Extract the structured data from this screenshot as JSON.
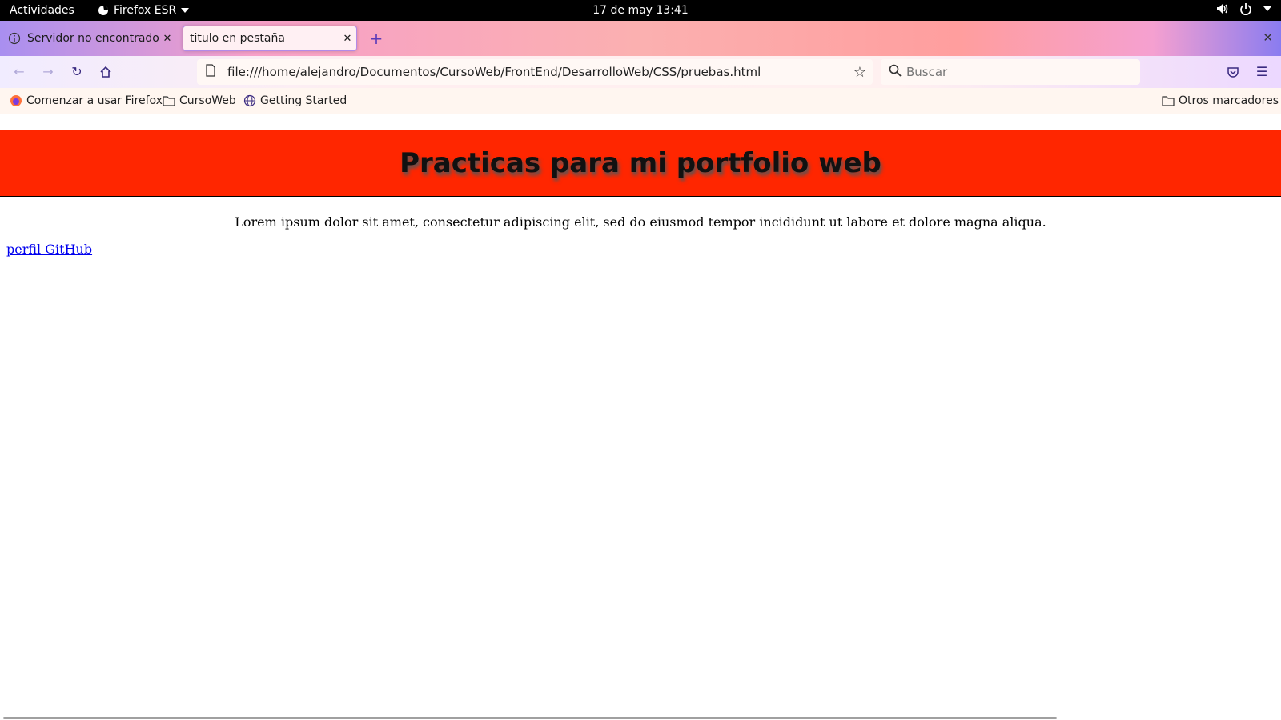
{
  "system": {
    "activities": "Actividades",
    "app_name": "Firefox ESR",
    "clock": "17 de may  13:41",
    "volume_icon": "volume-icon",
    "power_icon": "power-icon"
  },
  "tabs": [
    {
      "label": "Servidor no encontrado",
      "icon": "info-icon",
      "active": false
    },
    {
      "label": "titulo en pestaña",
      "icon": "",
      "active": true
    }
  ],
  "navbar": {
    "url": "file:///home/alejandro/Documentos/CursoWeb/FrontEnd/DesarrolloWeb/CSS/pruebas.html",
    "search_placeholder": "Buscar"
  },
  "bookmarks": [
    {
      "label": "Comenzar a usar Firefox",
      "icon": "firefox-icon"
    },
    {
      "label": "CursoWeb",
      "icon": "folder-icon"
    },
    {
      "label": "Getting Started",
      "icon": "globe-icon"
    }
  ],
  "other_bookmarks": "Otros marcadores",
  "page": {
    "heading": "Practicas para mi portfolio web",
    "paragraph": "Lorem ipsum dolor sit amet, consectetur adipiscing elit, sed do eiusmod tempor incididunt ut labore et dolore magna aliqua.",
    "link": "perfil GitHub"
  },
  "colors": {
    "header_bg": "#ff2600",
    "link": "#0000ee"
  }
}
